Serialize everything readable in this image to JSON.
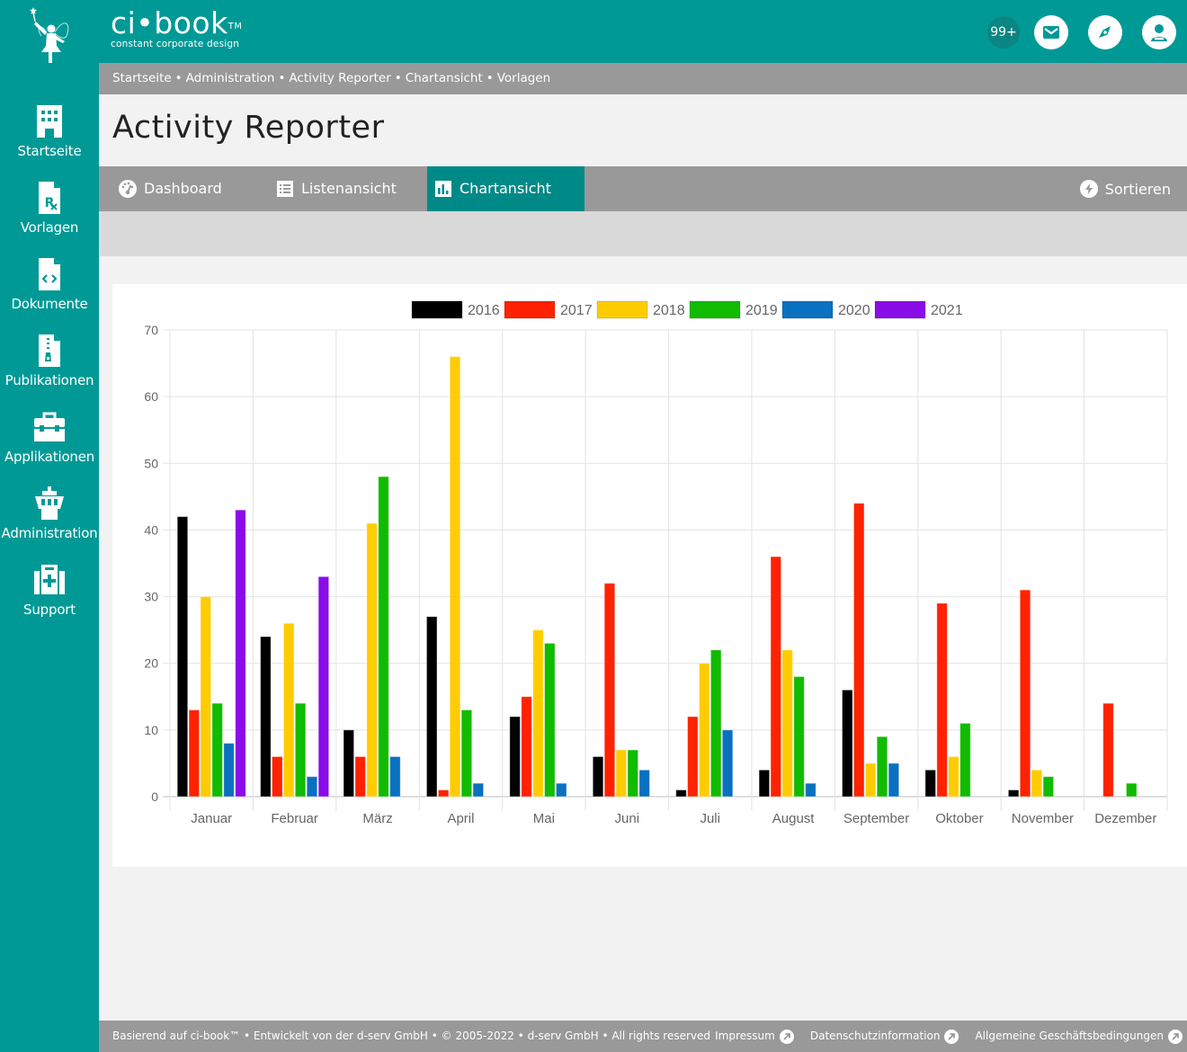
{
  "header": {
    "brand_name": "ci•book",
    "brand_tm": "TM",
    "brand_tagline": "constant corporate design",
    "notification_count": "99+",
    "icons": [
      "mail-icon",
      "compass-icon",
      "user-icon"
    ]
  },
  "sidebar": {
    "items": [
      {
        "label": "Startseite",
        "icon": "building-icon"
      },
      {
        "label": "Vorlagen",
        "icon": "prescription-file-icon"
      },
      {
        "label": "Dokumente",
        "icon": "code-file-icon"
      },
      {
        "label": "Publikationen",
        "icon": "zip-file-icon"
      },
      {
        "label": "Applikationen",
        "icon": "toolbox-icon"
      },
      {
        "label": "Administration",
        "icon": "control-tower-icon"
      },
      {
        "label": "Support",
        "icon": "hospital-icon"
      }
    ]
  },
  "breadcrumb": {
    "items": [
      "Startseite",
      "Administration",
      "Activity Reporter",
      "Chartansicht",
      "Vorlagen"
    ],
    "separator": "•"
  },
  "page": {
    "title": "Activity Reporter"
  },
  "tabs": {
    "items": [
      {
        "label": "Dashboard",
        "icon": "gauge-icon",
        "active": false
      },
      {
        "label": "Listenansicht",
        "icon": "list-icon",
        "active": false
      },
      {
        "label": "Chartansicht",
        "icon": "bar-chart-icon",
        "active": true
      }
    ],
    "sort_label": "Sortieren",
    "sort_icon": "bolt-icon"
  },
  "colors": {
    "brand": "#009996",
    "active_tab": "#008a87",
    "bar_gray": "#999999"
  },
  "chart_data": {
    "type": "bar",
    "title": "",
    "xlabel": "",
    "ylabel": "",
    "ylim": [
      0,
      70
    ],
    "yticks": [
      0,
      10,
      20,
      30,
      40,
      50,
      60,
      70
    ],
    "grid": true,
    "legend_position": "top",
    "categories": [
      "Januar",
      "Februar",
      "März",
      "April",
      "Mai",
      "Juni",
      "Juli",
      "August",
      "September",
      "Oktober",
      "November",
      "Dezember"
    ],
    "series": [
      {
        "name": "2016",
        "color": "#000000",
        "values": [
          42,
          24,
          10,
          27,
          12,
          6,
          1,
          4,
          16,
          4,
          1,
          0
        ]
      },
      {
        "name": "2017",
        "color": "#ff2200",
        "values": [
          13,
          6,
          6,
          1,
          15,
          32,
          12,
          36,
          44,
          29,
          31,
          14
        ]
      },
      {
        "name": "2018",
        "color": "#ffcc00",
        "values": [
          30,
          26,
          41,
          66,
          25,
          7,
          20,
          22,
          5,
          6,
          4,
          0
        ]
      },
      {
        "name": "2019",
        "color": "#11bb00",
        "values": [
          14,
          14,
          48,
          13,
          23,
          7,
          22,
          18,
          9,
          11,
          3,
          2
        ]
      },
      {
        "name": "2020",
        "color": "#0a70c0",
        "values": [
          8,
          3,
          6,
          2,
          2,
          4,
          10,
          2,
          5,
          0,
          0,
          0
        ]
      },
      {
        "name": "2021",
        "color": "#8a0ce8",
        "values": [
          43,
          33,
          0,
          0,
          0,
          0,
          0,
          0,
          0,
          0,
          0,
          0
        ]
      }
    ]
  },
  "footer": {
    "text": "Basierend auf ci-book™ • Entwickelt von der d-serv GmbH • © 2005-2022 • d-serv GmbH • All rights reserved",
    "links": [
      "Impressum",
      "Datenschutzinformation",
      "Allgemeine Geschäftsbedingungen"
    ]
  }
}
